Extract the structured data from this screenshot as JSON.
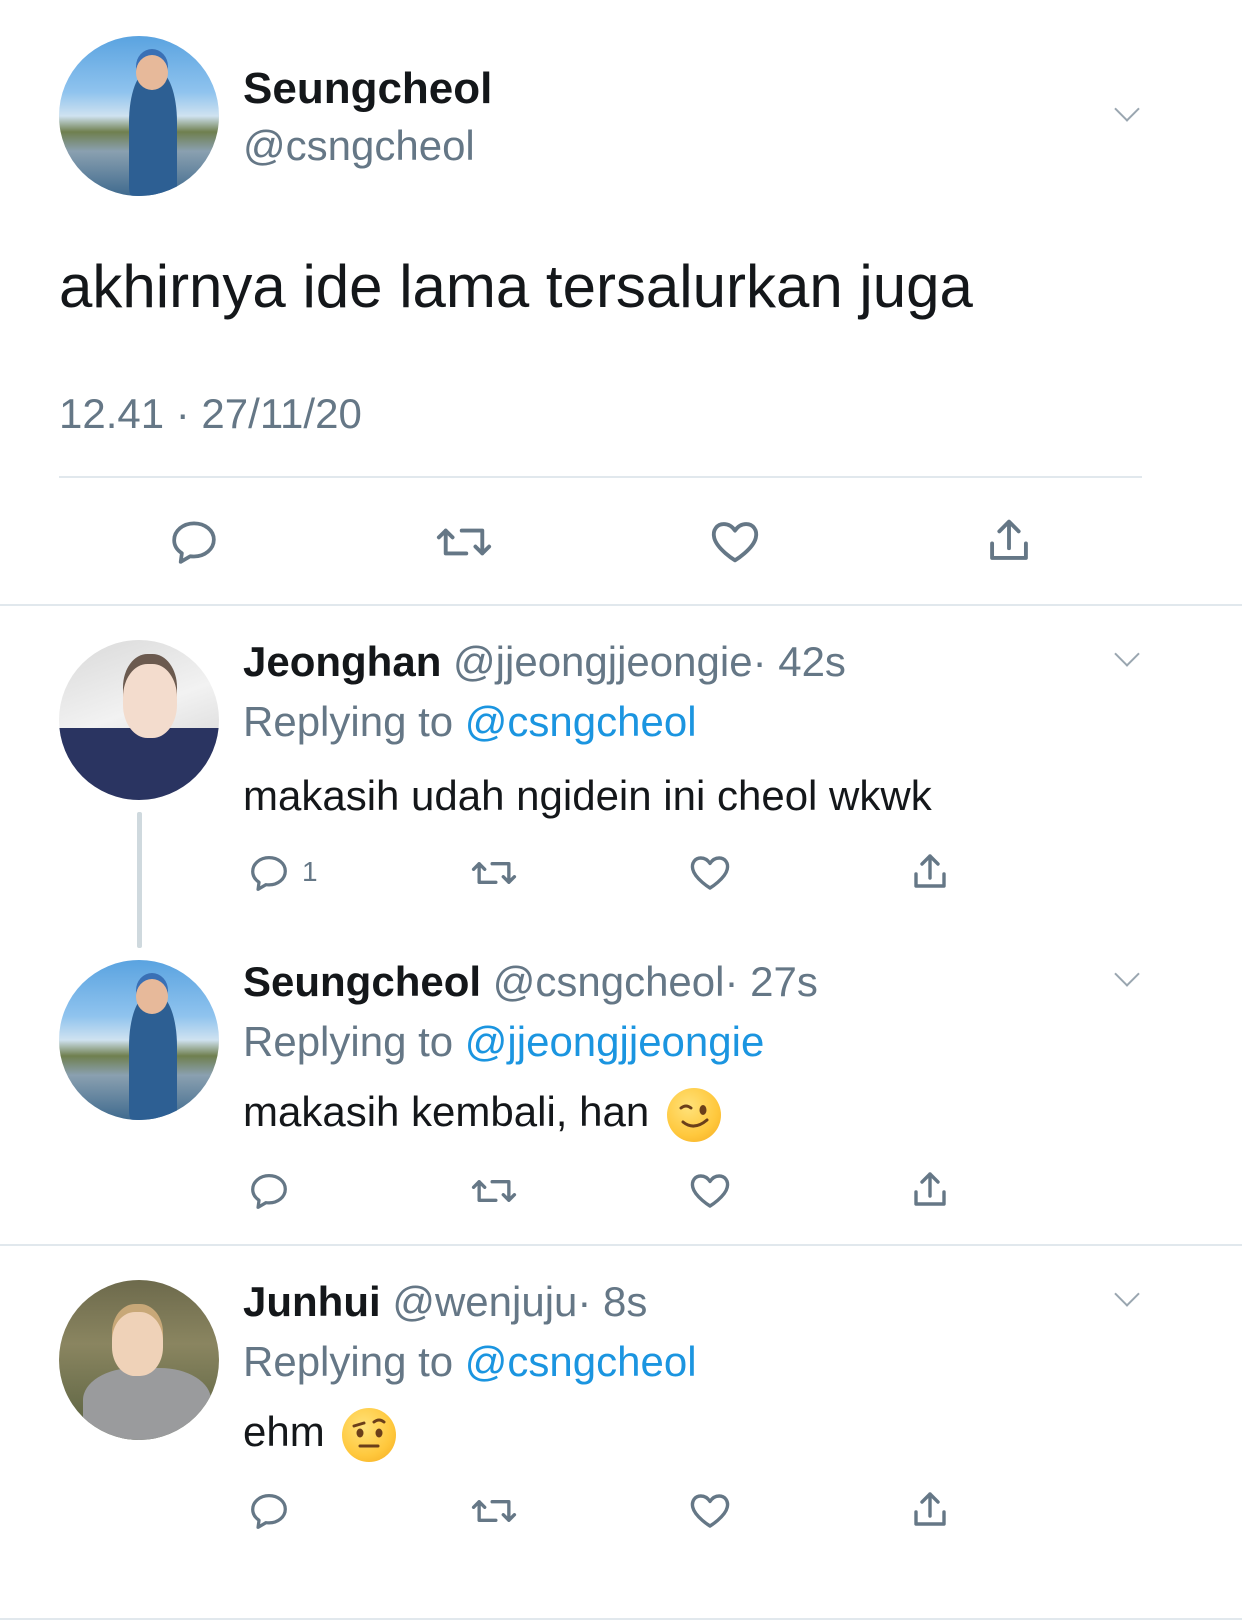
{
  "main_tweet": {
    "author_name": "Seungcheol",
    "author_handle": "@csngcheol",
    "text": "akhirnya ide lama tersalurkan juga",
    "timestamp": "12.41 · 27/11/20"
  },
  "replies": [
    {
      "author_name": "Jeonghan",
      "author_handle": "@jjeongjjeongie",
      "time": "· 42s",
      "replying_label": "Replying to",
      "replying_to": "@csngcheol",
      "text": "makasih udah ngidein ini cheol wkwk",
      "reply_count": "1"
    },
    {
      "author_name": "Seungcheol",
      "author_handle": "@csngcheol",
      "time": "· 27s",
      "replying_label": "Replying to",
      "replying_to": "@jjeongjjeongie",
      "text": "makasih kembali, han",
      "emoji": "winking-face"
    },
    {
      "author_name": "Junhui",
      "author_handle": "@wenjuju",
      "time": "· 8s",
      "replying_label": "Replying to",
      "replying_to": "@csngcheol",
      "text": "ehm",
      "emoji": "face-with-raised-eyebrow"
    }
  ],
  "colors": {
    "link": "#1b95e0",
    "secondary": "#657786",
    "divider": "#e1e8ed",
    "icon": "#657786"
  }
}
